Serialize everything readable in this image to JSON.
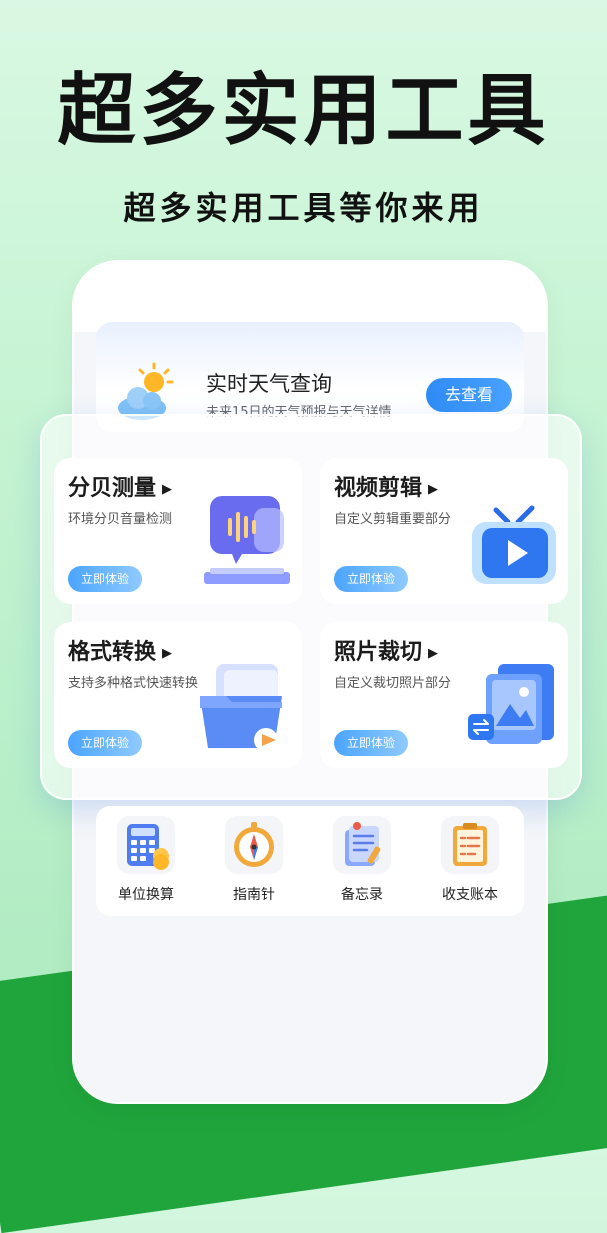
{
  "hero": {
    "title": "超多实用工具",
    "subtitle": "超多实用工具等你来用"
  },
  "weather": {
    "title": "实时天气查询",
    "description": "未来15日的天气预报与天气详情",
    "button": "去查看",
    "icon": "sun-cloud-icon"
  },
  "tools": [
    {
      "title": "分贝测量",
      "description": "环境分贝音量检测",
      "button": "立即体验",
      "icon": "sound-wave-icon"
    },
    {
      "title": "视频剪辑",
      "description": "自定义剪辑重要部分",
      "button": "立即体验",
      "icon": "tv-play-icon"
    },
    {
      "title": "格式转换",
      "description": "支持多种格式快速转换",
      "button": "立即体验",
      "icon": "folder-icon"
    },
    {
      "title": "照片裁切",
      "description": "自定义裁切照片部分",
      "button": "立即体验",
      "icon": "photo-icon"
    }
  ],
  "quick_tools": [
    {
      "label": "单位换算",
      "icon": "calculator-icon"
    },
    {
      "label": "指南针",
      "icon": "compass-icon"
    },
    {
      "label": "备忘录",
      "icon": "memo-icon"
    },
    {
      "label": "收支账本",
      "icon": "ledger-icon"
    }
  ],
  "colors": {
    "accent_blue": "#2f8cf5",
    "green": "#20a53c",
    "background": "#c7f4d4"
  }
}
